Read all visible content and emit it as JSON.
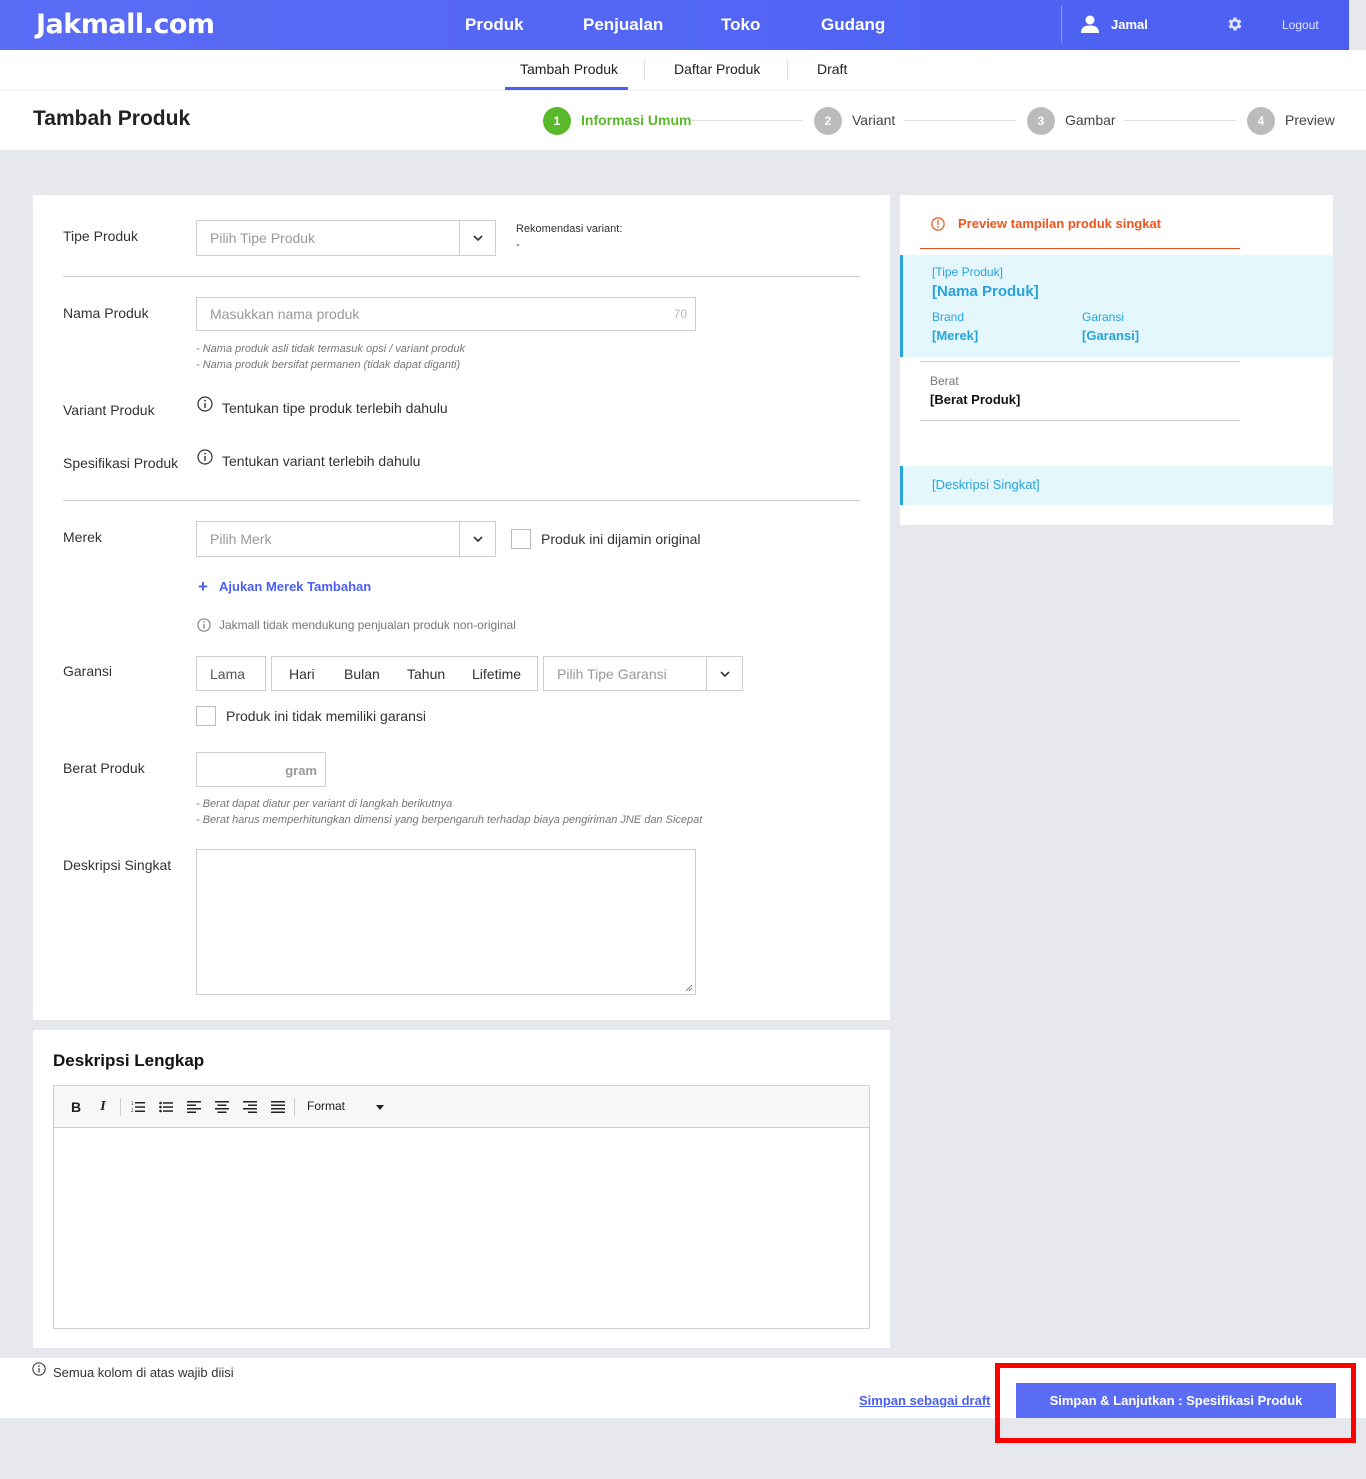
{
  "brand": {
    "logo": "Jakmall.com"
  },
  "topnav": {
    "items": [
      "Produk",
      "Penjualan",
      "Toko",
      "Gudang"
    ],
    "user": "Jamal",
    "logout": "Logout"
  },
  "subnav": {
    "items": [
      "Tambah Produk",
      "Daftar Produk",
      "Draft"
    ]
  },
  "header": {
    "title": "Tambah Produk",
    "steps": [
      {
        "num": "1",
        "label": "Informasi Umum"
      },
      {
        "num": "2",
        "label": "Variant"
      },
      {
        "num": "3",
        "label": "Gambar"
      },
      {
        "num": "4",
        "label": "Preview"
      }
    ]
  },
  "form": {
    "tipe_produk": {
      "label": "Tipe Produk",
      "placeholder": "Pilih Tipe Produk",
      "rekom_label": "Rekomendasi variant:",
      "rekom_value": "-"
    },
    "nama_produk": {
      "label": "Nama Produk",
      "placeholder": "Masukkan nama produk",
      "counter": "70",
      "hints": [
        "-  Nama produk asli tidak termasuk opsi / variant produk",
        "-  Nama produk bersifat permanen (tidak dapat diganti)"
      ]
    },
    "variant_produk": {
      "label": "Variant Produk",
      "info": "Tentukan tipe produk terlebih dahulu"
    },
    "spesifikasi_produk": {
      "label": "Spesifikasi Produk",
      "info": "Tentukan variant terlebih dahulu"
    },
    "merek": {
      "label": "Merek",
      "placeholder": "Pilih Merk",
      "original_check": "Produk ini dijamin original",
      "ajukan": "Ajukan Merek Tambahan",
      "note": "Jakmall tidak mendukung penjualan produk non-original"
    },
    "garansi": {
      "label": "Garansi",
      "lama": "Lama",
      "units": [
        "Hari",
        "Bulan",
        "Tahun",
        "Lifetime"
      ],
      "tipe_placeholder": "Pilih Tipe Garansi",
      "no_garansi": "Produk ini tidak memiliki garansi"
    },
    "berat": {
      "label": "Berat Produk",
      "unit": "gram",
      "hints": [
        "-  Berat dapat diatur per variant di langkah berikutnya",
        "-  Berat harus memperhitungkan dimensi yang berpengaruh terhadap biaya pengiriman JNE dan Sicepat"
      ]
    },
    "deskripsi_singkat": {
      "label": "Deskripsi Singkat"
    }
  },
  "editor": {
    "title": "Deskripsi Lengkap",
    "format": "Format",
    "bold": "B",
    "italic": "I"
  },
  "preview": {
    "header": "Preview tampilan produk singkat",
    "tipe": "[Tipe Produk]",
    "nama": "[Nama Produk]",
    "brand_label": "Brand",
    "brand_value": "[Merek]",
    "garansi_label": "Garansi",
    "garansi_value": "[Garansi]",
    "berat_label": "Berat",
    "berat_value": "[Berat Produk]",
    "deskripsi": "[Deskripsi Singkat]"
  },
  "footer": {
    "note": "Semua kolom di atas wajib diisi",
    "draft": "Simpan sebagai draft",
    "submit": "Simpan & Lanjutkan : Spesifikasi Produk"
  },
  "colors": {
    "primary": "#4a5ff2",
    "success": "#5ab82b",
    "warning": "#f0541e",
    "preview_bg": "#e3f7fd",
    "preview_text": "#29a3db",
    "highlight": "#ff0000"
  }
}
